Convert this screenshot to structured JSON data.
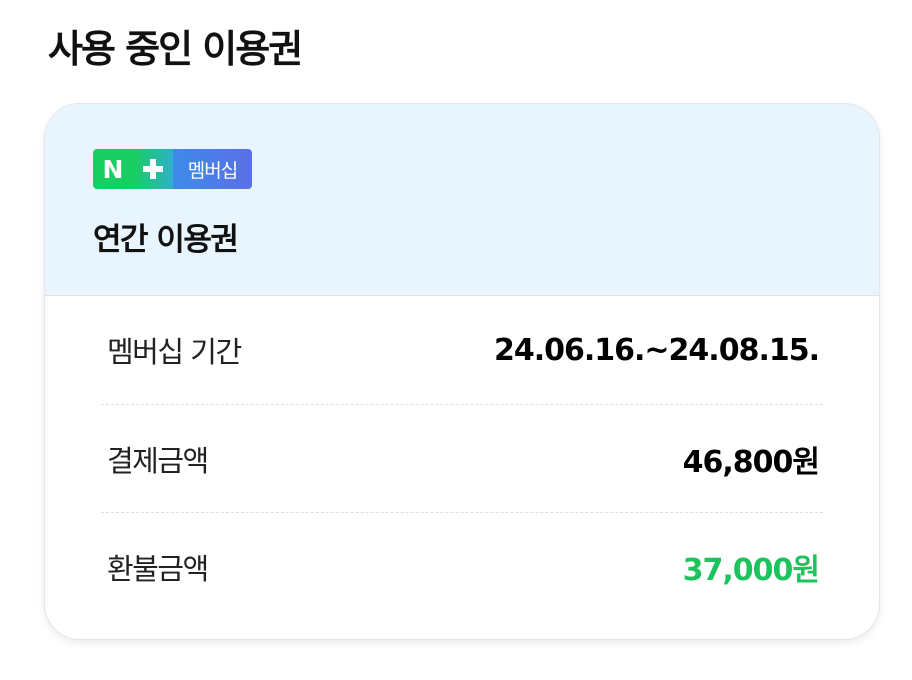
{
  "page": {
    "title": "사용 중인 이용권"
  },
  "membership_card": {
    "badge": {
      "n_letter": "N",
      "plus": "+",
      "label": "멤버십"
    },
    "plan_name": "연간 이용권",
    "rows": [
      {
        "label": "멤버십 기간",
        "value": "24.06.16.~24.08.15."
      },
      {
        "label": "결제금액",
        "value": "46,800원"
      },
      {
        "label": "환불금액",
        "value": "37,000원"
      }
    ]
  },
  "colors": {
    "header_bg": "#e8f4fe",
    "naver_green": "#19ce60",
    "membership_blue": "#4a7de8",
    "refund_green": "#1dc35c"
  }
}
